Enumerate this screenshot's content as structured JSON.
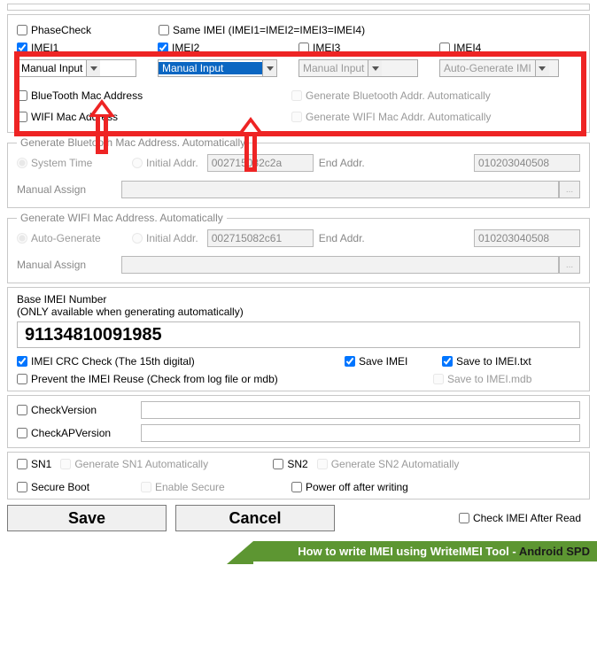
{
  "top": {
    "phaseCheck": "PhaseCheck",
    "sameIMEI": "Same IMEI (IMEI1=IMEI2=IMEI3=IMEI4)",
    "imei1": "IMEI1",
    "imei2": "IMEI2",
    "imei3": "IMEI3",
    "imei4": "IMEI4",
    "dd1": "Manual Input",
    "dd2": "Manual Input",
    "dd3": "Manual Input",
    "dd4": "Auto-Generate IMI",
    "btMac": "BlueTooth Mac Address",
    "genBtAuto": "Generate Bluetooth Addr. Automatically",
    "wifiMac": "WIFI Mac Address",
    "genWifiAuto": "Generate WIFI Mac Addr. Automatically"
  },
  "btGroup": {
    "legend": "Generate Bluetooth Mac Address. Automatically",
    "sysTime": "System Time",
    "initAddr": "Initial Addr.",
    "initVal": "002715082c2a",
    "endLabel": "End Addr.",
    "endVal": "010203040508",
    "manual": "Manual Assign"
  },
  "wifiGroup": {
    "legend": "Generate WIFI Mac Address. Automatically",
    "autoGen": "Auto-Generate",
    "initAddr": "Initial Addr.",
    "initVal": "002715082c61",
    "endLabel": "End Addr.",
    "endVal": "010203040508",
    "manual": "Manual Assign"
  },
  "base": {
    "line1": "Base IMEI Number",
    "line2": "(ONLY available when generating automatically)",
    "value": "91134810091985",
    "crc": "IMEI CRC Check (The 15th digital)",
    "saveImei": "Save IMEI",
    "saveTxt": "Save to IMEI.txt",
    "preventReuse": "Prevent the IMEI Reuse (Check from log file or mdb)",
    "saveMdb": "Save to IMEI.mdb"
  },
  "ver": {
    "checkVersion": "CheckVersion",
    "checkAPVersion": "CheckAPVersion"
  },
  "sn": {
    "sn1": "SN1",
    "genSn1": "Generate SN1 Automatically",
    "sn2": "SN2",
    "genSn2": "Generate SN2 Automatially",
    "secureBoot": "Secure Boot",
    "enableSecure": "Enable Secure",
    "powerOff": "Power off after writing"
  },
  "btns": {
    "save": "Save",
    "cancel": "Cancel",
    "checkAfter": "Check IMEI After Read"
  },
  "footer": {
    "p1": "How to write IMEI using WriteIMEI Tool - ",
    "p2": "Android SPD"
  },
  "dots": "..."
}
